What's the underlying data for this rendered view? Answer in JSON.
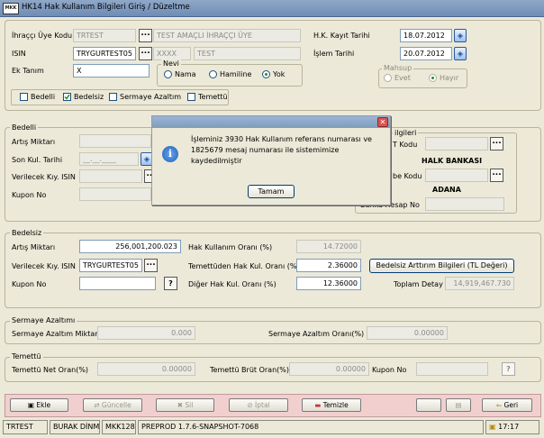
{
  "window": {
    "logo": "MKK",
    "title": "HK14 Hak Kullanım Bilgileri Giriş / Düzeltme"
  },
  "top": {
    "issuer_label": "İhraççı Üye Kodu",
    "issuer_code": "TRTEST",
    "issuer_name": "TEST AMAÇLI İHRAÇÇI ÜYE",
    "isin_label": "ISIN",
    "isin_value": "TRYGURTEST05",
    "isin_code2": "XXXX",
    "isin_name": "TEST",
    "ek_label": "Ek Tanım",
    "ek_value": "X",
    "hk_date_label": "H.K. Kayıt Tarihi",
    "hk_date": "18.07.2012",
    "islem_label": "İşlem Tarihi",
    "islem_date": "20.07.2012",
    "nevi_label": "Nevi",
    "nevi_options": [
      "Nama",
      "Hamiline",
      "Yok"
    ],
    "nevi_selected": "Yok",
    "mahsup_label": "Mahsup",
    "mahsup_options": [
      "Evet",
      "Hayır"
    ],
    "mahsup_selected": "Hayır",
    "checks": [
      {
        "label": "Bedelli",
        "checked": false
      },
      {
        "label": "Bedelsiz",
        "checked": true
      },
      {
        "label": "Sermaye Azaltım",
        "checked": false
      },
      {
        "label": "Temettü",
        "checked": false
      }
    ]
  },
  "bedelli": {
    "title": "Bedelli",
    "artis_label": "Artış Miktarı",
    "son_kul_label": "Son Kul. Tarihi",
    "son_kul_placeholder": "__.__.____",
    "verilecek_label": "Verilecek Kıy. ISIN",
    "kupon_label": "Kupon No",
    "right_title": "ilgileri",
    "t_kodu_label": "T Kodu",
    "bank_name": "HALK BANKASI",
    "sube_label": "be Kodu",
    "sube_name": "ADANA",
    "hesap_label": "Banka Hesap No"
  },
  "bedelsiz": {
    "title": "Bedelsiz",
    "artis_label": "Artış Miktarı",
    "artis_value": "256,001,200.023",
    "hk_oran_label": "Hak Kullanım Oranı (%)",
    "hk_oran_value": "14.72000",
    "verilecek_label": "Verilecek Kıy. ISIN",
    "verilecek_value": "TRYGURTEST05",
    "temettu_oran_label": "Temettüden Hak Kul. Oranı (%)",
    "temettu_oran_value": "2.36000",
    "artirim_button": "Bedelsiz Arttırım Bilgileri (TL Değeri)",
    "kupon_label": "Kupon No",
    "help_button": "?",
    "diger_label": "Diğer Hak Kul. Oranı (%)",
    "diger_value": "12.36000",
    "toplam_label": "Toplam Detay",
    "toplam_value": "14,919,467.730"
  },
  "sermaye": {
    "title": "Sermaye Azaltımı",
    "miktar_label": "Sermaye Azaltım Miktarı",
    "miktar_value": "0.000",
    "oran_label": "Sermaye Azaltım Oranı(%)",
    "oran_value": "0.00000"
  },
  "temettu": {
    "title": "Temettü",
    "net_label": "Temettü Net Oran(%)",
    "net_value": "0.00000",
    "brut_label": "Temettü Brüt Oran(%)",
    "brut_value": "0.00000",
    "kupon_label": "Kupon No",
    "help_button": "?"
  },
  "toolbar": {
    "ekle": "Ekle",
    "guncelle": "Güncelle",
    "sil": "Sil",
    "iptal": "İptal",
    "temizle": "Temizle",
    "geri": "Geri"
  },
  "status": {
    "c1": "TRTEST",
    "c2": "BURAK DİNMEZ",
    "c3": "MKK128",
    "c4": "PREPROD 1.7.6-SNAPSHOT-7068",
    "time": "17:17"
  },
  "dialog": {
    "message": "İşleminiz 3930 Hak Kullanım referans numarası ve 1825679 mesaj numarası ile sistemimize kaydedilmiştir",
    "ok": "Tamam",
    "close": "✕"
  },
  "colors": {
    "accent": "#7f9db9",
    "toolbar_bg": "#f2cfcf",
    "window_bg": "#ece9d8"
  }
}
